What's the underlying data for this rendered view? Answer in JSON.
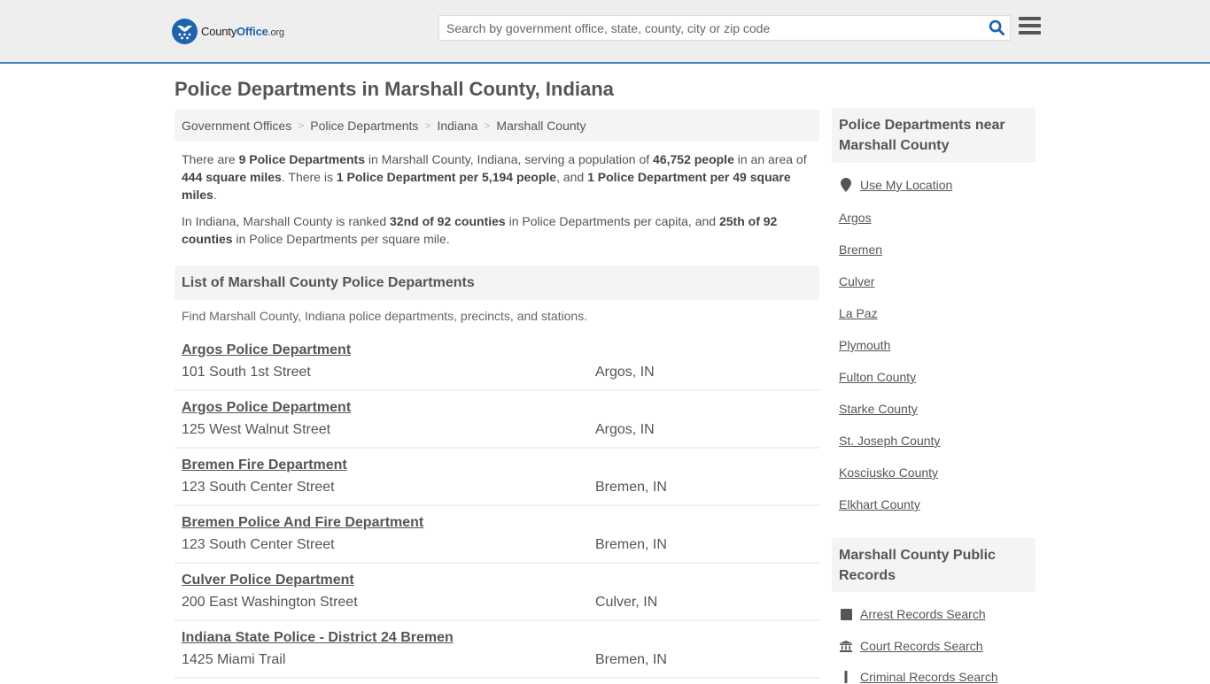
{
  "header": {
    "logo": {
      "county": "County",
      "office": "Office",
      "org": ".org"
    },
    "search_placeholder": "Search by government office, state, county, city or zip code",
    "search_icon": "search-icon",
    "menu_icon": "hamburger-menu-icon"
  },
  "page_title": "Police Departments in Marshall County, Indiana",
  "breadcrumb": [
    "Government Offices",
    "Police Departments",
    "Indiana",
    "Marshall County"
  ],
  "intro": {
    "p1": {
      "t1": "There are ",
      "b1": "9 Police Departments",
      "t2": " in Marshall County, Indiana, serving a population of ",
      "b2": "46,752 people",
      "t3": " in an area of ",
      "b3": "444 square miles",
      "t4": ". There is ",
      "b4": "1 Police Department per 5,194 people",
      "t5": ", and ",
      "b5": "1 Police Department per 49 square miles",
      "t6": "."
    },
    "p2": {
      "t1": "In Indiana, Marshall County is ranked ",
      "b1": "32nd of 92 counties",
      "t2": " in Police Departments per capita, and ",
      "b2": "25th of 92 counties",
      "t3": " in Police Departments per square mile."
    }
  },
  "list": {
    "heading": "List of Marshall County Police Departments",
    "description": "Find Marshall County, Indiana police departments, precincts, and stations.",
    "items": [
      {
        "name": "Argos Police Department",
        "address": "101 South 1st Street",
        "city": "Argos, IN"
      },
      {
        "name": "Argos Police Department",
        "address": "125 West Walnut Street",
        "city": "Argos, IN"
      },
      {
        "name": "Bremen Fire Department",
        "address": "123 South Center Street",
        "city": "Bremen, IN"
      },
      {
        "name": "Bremen Police And Fire Department",
        "address": "123 South Center Street",
        "city": "Bremen, IN"
      },
      {
        "name": "Culver Police Department",
        "address": "200 East Washington Street",
        "city": "Culver, IN"
      },
      {
        "name": "Indiana State Police - District 24 Bremen",
        "address": "1425 Miami Trail",
        "city": "Bremen, IN"
      }
    ]
  },
  "sidebar": {
    "near_heading": "Police Departments near Marshall County",
    "use_location": "Use My Location",
    "near_links": [
      "Argos",
      "Bremen",
      "Culver",
      "La Paz",
      "Plymouth",
      "Fulton County",
      "Starke County",
      "St. Joseph County",
      "Kosciusko County",
      "Elkhart County"
    ],
    "records_heading": "Marshall County Public Records",
    "records_links": [
      {
        "label": "Arrest Records Search",
        "icon": "square-icon"
      },
      {
        "label": "Court Records Search",
        "icon": "courthouse-icon"
      },
      {
        "label": "Criminal Records Search",
        "icon": "baton-icon"
      }
    ]
  },
  "colors": {
    "brand_blue": "#1f63ad",
    "header_bg": "#eeeeee",
    "header_border": "#3d7eb3",
    "box_bg": "#f4f4f4"
  }
}
